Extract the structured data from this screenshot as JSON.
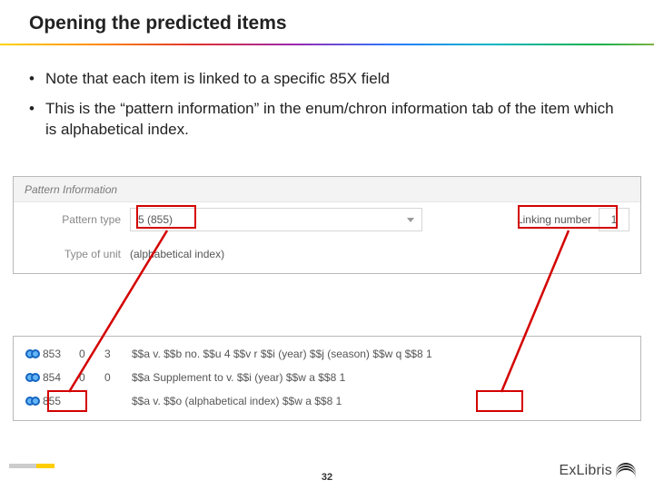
{
  "title": "Opening the predicted items",
  "bullets": [
    "Note that each item is linked to a specific 85X field",
    "This is the “pattern information” in the enum/chron information tab of the item which is alphabetical index."
  ],
  "panel1": {
    "header": "Pattern Information",
    "row1_label": "Pattern type",
    "row1_value": "5 (855)",
    "linking_label": "Linking number",
    "linking_value": "1",
    "row2_label": "Type of unit",
    "row2_value": "(alphabetical index)"
  },
  "panel2": {
    "rows": [
      {
        "tag": "853",
        "i1": "0",
        "i2": "3",
        "subf": "$$a v. $$b no. $$u 4 $$v r $$i (year) $$j (season) $$w q $$8 1"
      },
      {
        "tag": "854",
        "i1": "0",
        "i2": "0",
        "subf": "$$a Supplement to v. $$i (year) $$w a $$8 1"
      },
      {
        "tag": "855",
        "i1": "",
        "i2": "",
        "subf": "$$a v. $$o (alphabetical index) $$w a $$8 1"
      }
    ]
  },
  "page_number": "32",
  "logo_text": "ExLibris"
}
